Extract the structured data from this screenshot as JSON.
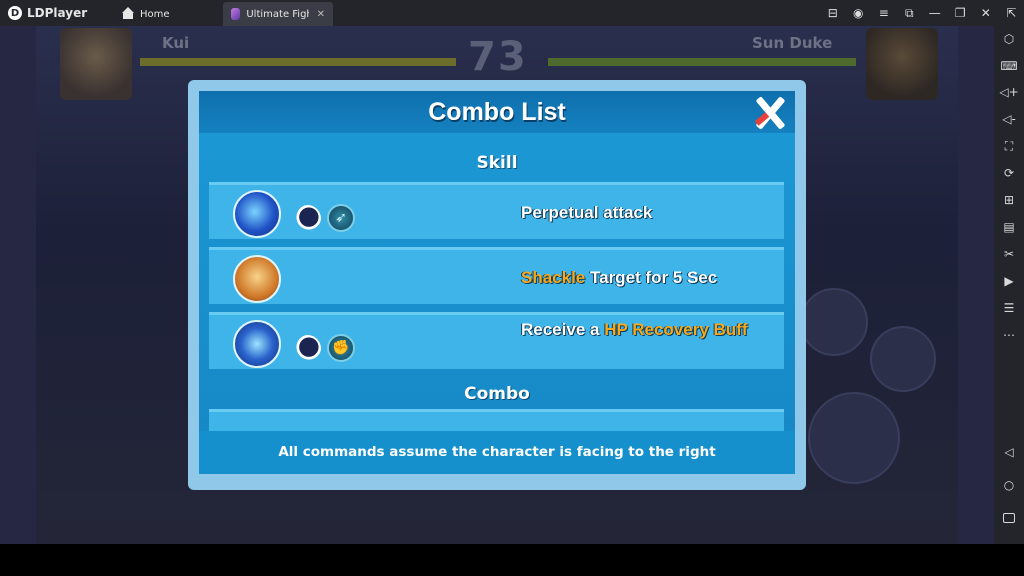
{
  "emulator": {
    "brand": "LDPlayer",
    "tabs": [
      {
        "label": "Home",
        "icon": "home-icon"
      },
      {
        "label": "Ultimate Fight...",
        "icon": "game-icon",
        "close": "✕"
      }
    ],
    "window_controls": [
      "gamepad-icon",
      "account-icon",
      "menu-icon",
      "screen-icon",
      "minimize-icon",
      "restore-icon",
      "close-icon",
      "fullscreen-icon"
    ],
    "sidebar_tools": [
      "settings-icon",
      "keyboard-icon",
      "volume-up-icon",
      "volume-down-icon",
      "screenshot-icon",
      "rotate-icon",
      "add-icon",
      "apk-icon",
      "cut-icon",
      "video-icon",
      "file-icon",
      "more-icon",
      "back-icon",
      "home-nav-icon",
      "recent-icon"
    ]
  },
  "hud": {
    "player_left": "Kui",
    "player_right": "Sun Duke",
    "timer": "73"
  },
  "modal": {
    "title": "Combo List",
    "section_skill": "Skill",
    "section_combo": "Combo",
    "rows": [
      {
        "text_parts": [
          {
            "text": "Perpetual attack",
            "highlight": false
          }
        ]
      },
      {
        "text_parts": [
          {
            "text": "Shackle",
            "highlight": true
          },
          {
            "text": " Target for 5 Sec",
            "highlight": false
          }
        ]
      },
      {
        "text_parts": [
          {
            "text": "Receive a ",
            "highlight": false
          },
          {
            "text": "HP Recovery Buff",
            "highlight": true
          }
        ]
      }
    ],
    "footer": "All commands assume the character is facing to the right"
  },
  "colors": {
    "modal_blue": "#1c9ad6",
    "row_blue": "#3fb4e8",
    "highlight": "#f7a91b",
    "emulator_bar": "#23252b"
  }
}
